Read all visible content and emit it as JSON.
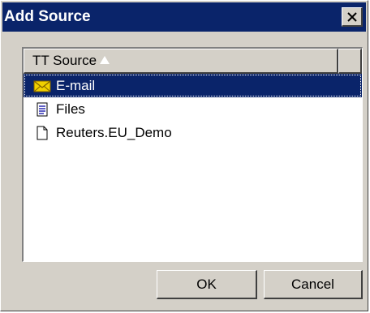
{
  "window": {
    "title": "Add Source",
    "close_glyph": "✕"
  },
  "list": {
    "column_header": "TT Source",
    "sort": "ascending",
    "items": [
      {
        "label": "E-mail",
        "icon": "envelope-icon",
        "selected": true
      },
      {
        "label": "Files",
        "icon": "text-file-icon",
        "selected": false
      },
      {
        "label": "Reuters.EU_Demo",
        "icon": "blank-file-icon",
        "selected": false
      }
    ]
  },
  "buttons": {
    "ok": "OK",
    "cancel": "Cancel"
  },
  "colors": {
    "titlebar": "#0a246a",
    "face": "#d4d0c8",
    "selection": "#0a246a",
    "envelope": "#f0d000"
  }
}
